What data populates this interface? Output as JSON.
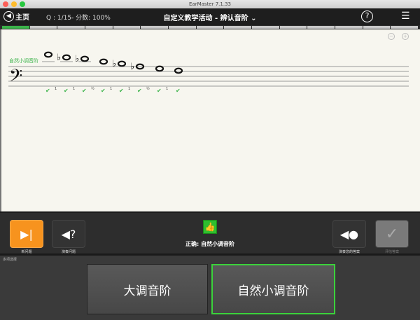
{
  "window": {
    "title": "EarMaster 7.1.33"
  },
  "toolbar": {
    "home_label": "主页",
    "score": "Q : 1/15- 分数: 100%",
    "title": "自定义教学活动 - 辨认音阶",
    "dropdown": "⌄",
    "help": "?",
    "menu": "☰"
  },
  "progress": {
    "total": 15,
    "completed": 1
  },
  "staff": {
    "scale_label": "自然小调音阶",
    "intervals": [
      "1",
      "1",
      "½",
      "1",
      "1",
      "½",
      "1"
    ],
    "check": "✔"
  },
  "controls": {
    "new_question": "新问题",
    "play_question": "演奏问题",
    "play_answer": "演奏您的答案",
    "evaluate": "评估答案",
    "result": "正确: 自然小调音阶"
  },
  "answers": {
    "section_label": "多项选择",
    "options": [
      "大调音阶",
      "自然小调音阶"
    ],
    "selected": 1
  },
  "colors": {
    "accent": "#f7931e",
    "correct": "#3bb34a"
  }
}
